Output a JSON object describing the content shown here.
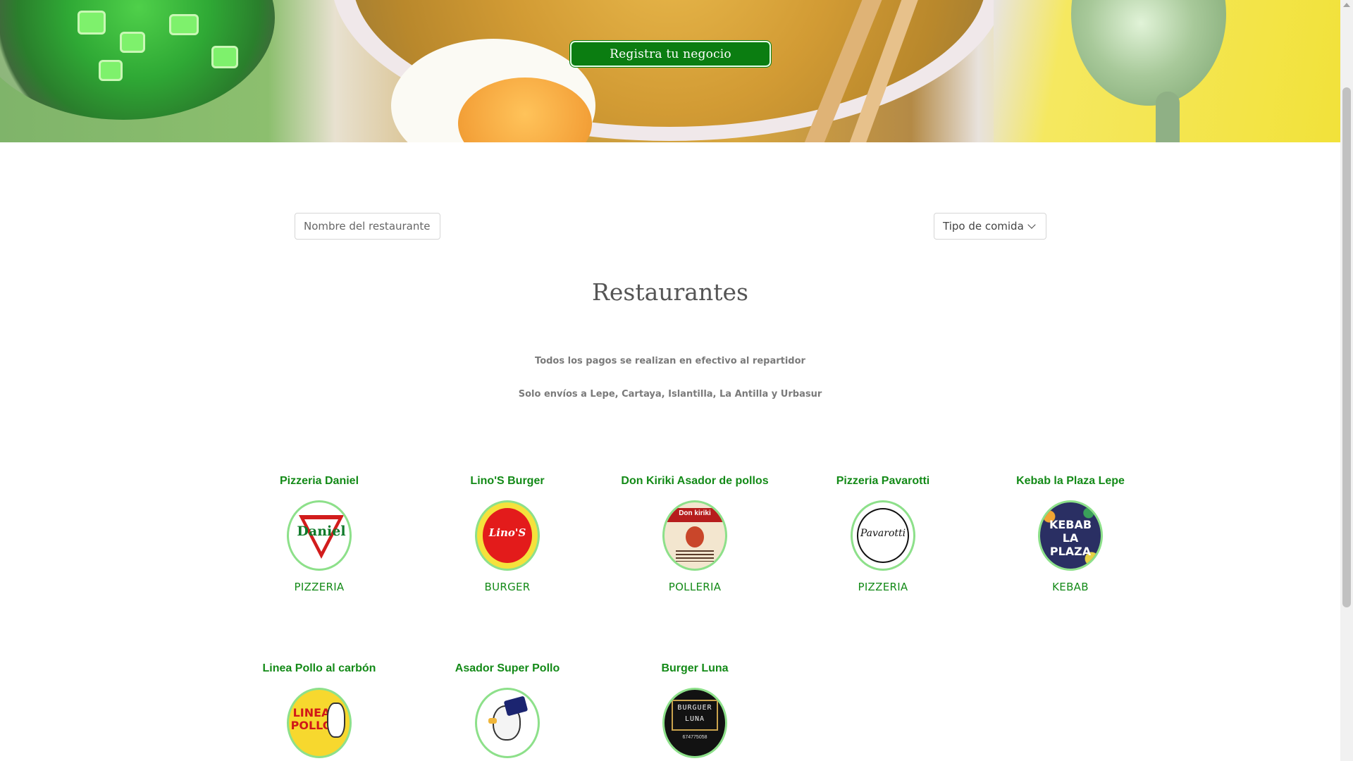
{
  "hero": {
    "register_button": "Registra tu negocio"
  },
  "filters": {
    "search_placeholder": "Nombre del restaurante",
    "food_type_label": "Tipo de comida"
  },
  "main": {
    "title": "Restaurantes",
    "notes": [
      "Todos los pagos se realizan en efectivo al repartidor",
      "Solo envíos a Lepe, Cartaya, Islantilla, La Antilla y Urbasur"
    ]
  },
  "restaurants": [
    {
      "name": "Pizzeria Daniel",
      "type": "PIZZERIA",
      "logo_text": "Daniel"
    },
    {
      "name": "Lino'S Burger",
      "type": "BURGER",
      "logo_text": "Lino'S"
    },
    {
      "name": "Don Kiriki Asador de pollos",
      "type": "POLLERIA",
      "logo_text": "Don kiriki"
    },
    {
      "name": "Pizzeria Pavarotti",
      "type": "PIZZERIA",
      "logo_text": "Pavarotti"
    },
    {
      "name": "Kebab la Plaza Lepe",
      "type": "KEBAB",
      "logo_text": "KEBAB LA PLAZA"
    },
    {
      "name": "Linea Pollo al carbón",
      "type": "",
      "logo_text": "LINEA POLLO"
    },
    {
      "name": "Asador Super Pollo",
      "type": "",
      "logo_text": ""
    },
    {
      "name": "Burger Luna",
      "type": "",
      "logo_text": "BURGUER LUNA",
      "logo_phone": "674775058"
    }
  ],
  "colors": {
    "accent_green": "#138a17",
    "button_green": "#0b7d11",
    "logo_border": "#8de08a"
  }
}
